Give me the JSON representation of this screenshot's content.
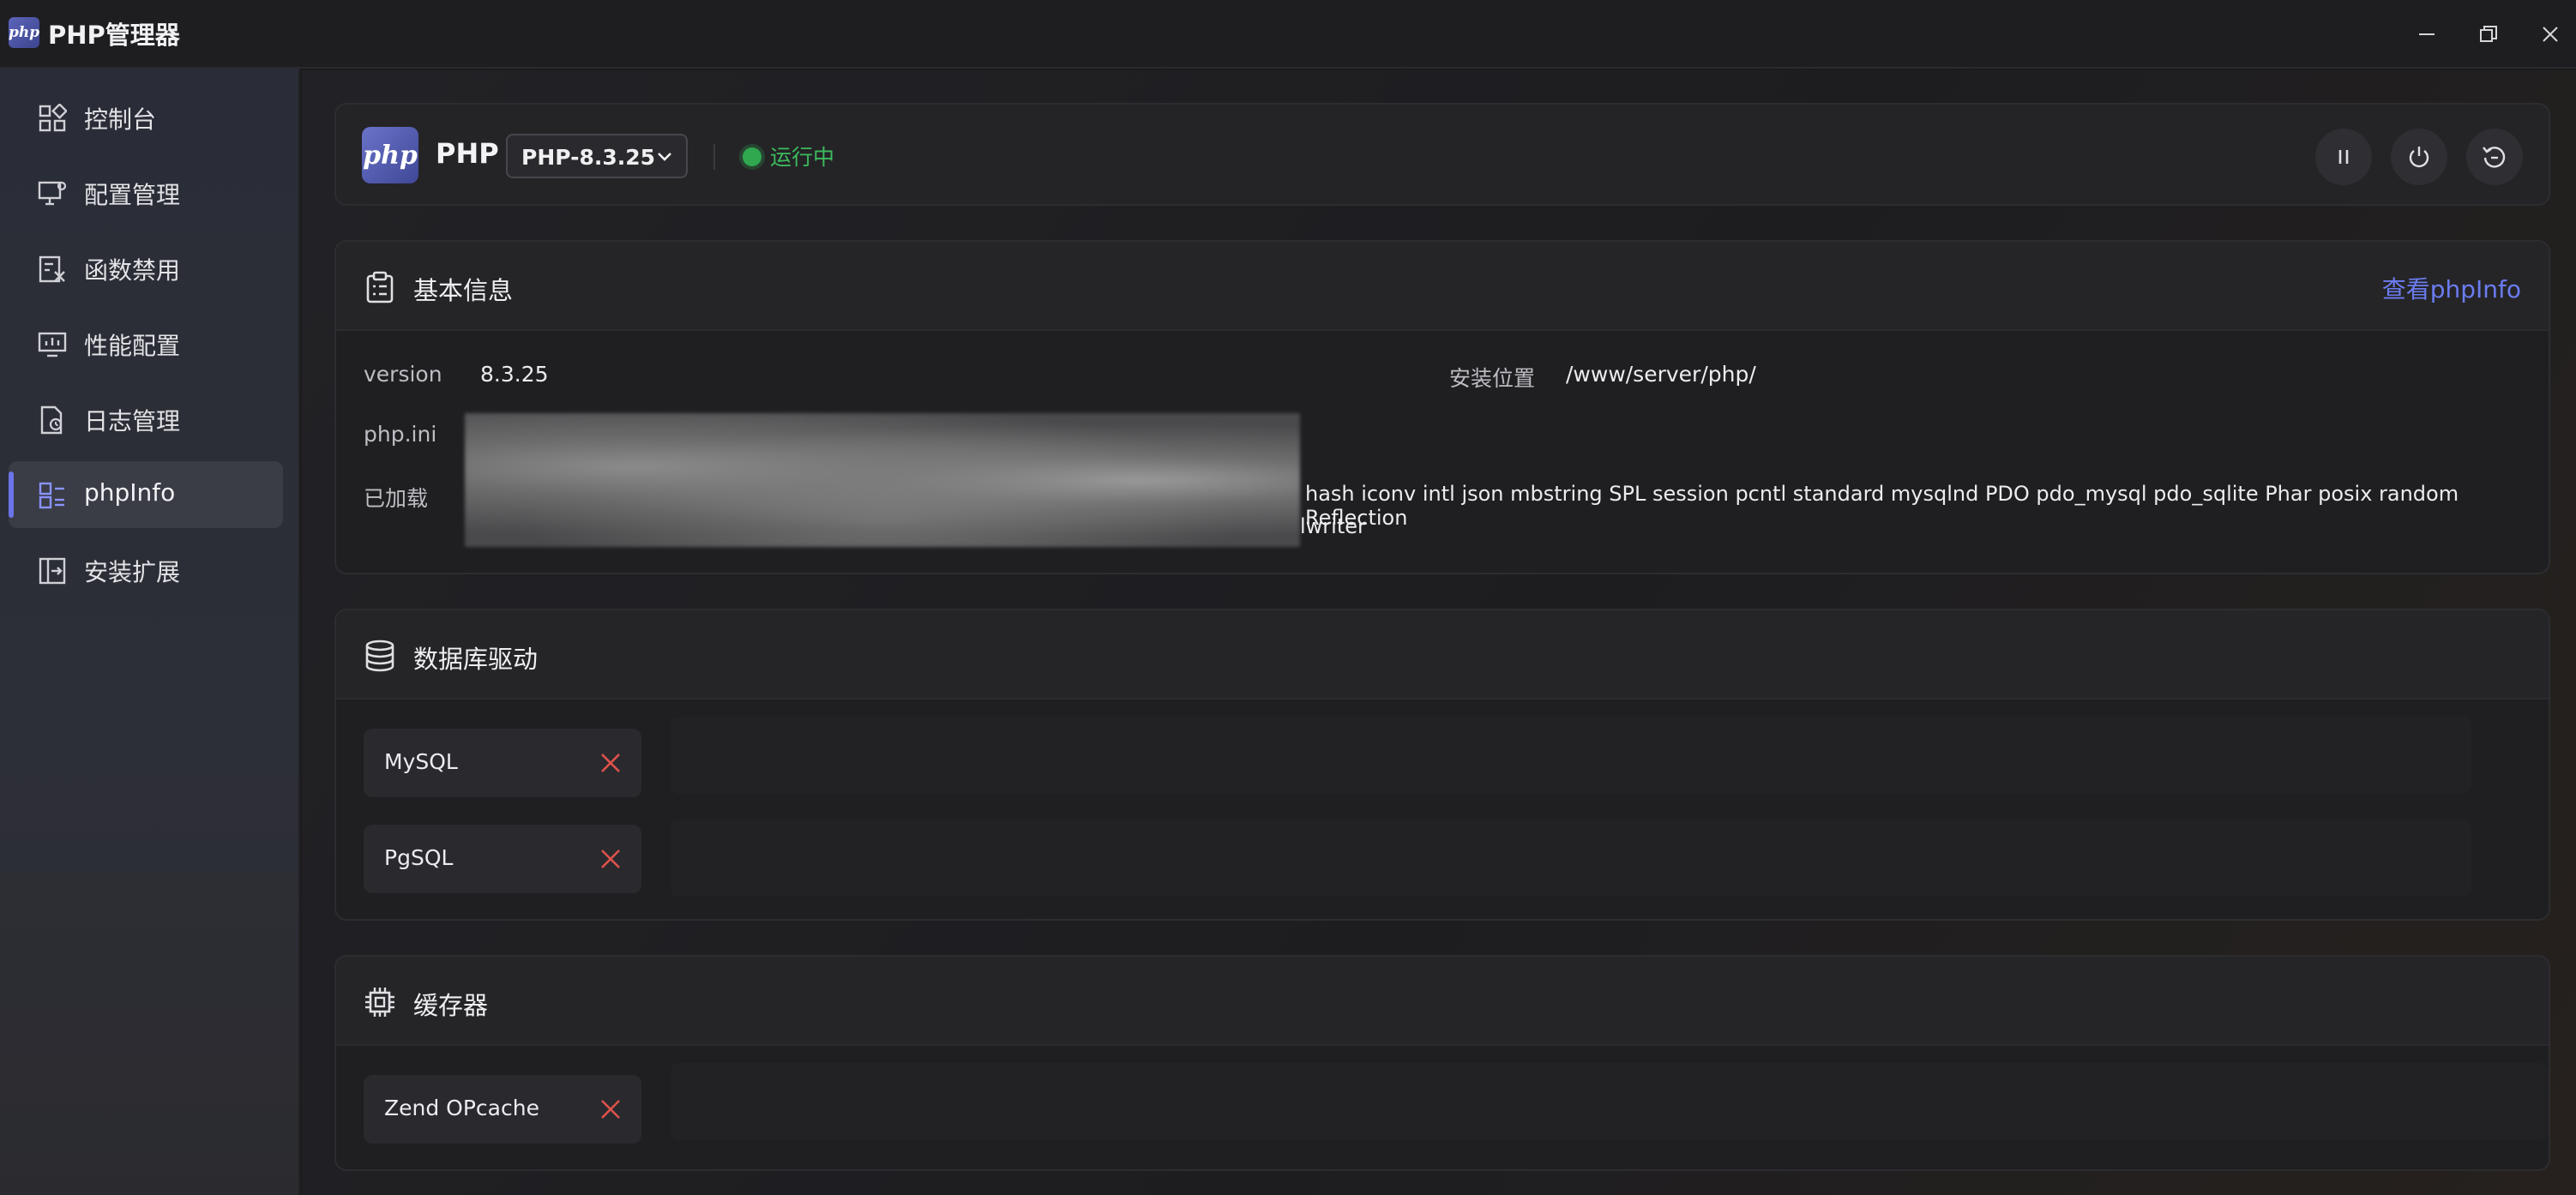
{
  "window": {
    "title": "PHP管理器",
    "logo_text": "php"
  },
  "sidebar": {
    "items": [
      {
        "label": "控制台",
        "icon": "dashboard-icon"
      },
      {
        "label": "配置管理",
        "icon": "config-monitor-icon"
      },
      {
        "label": "函数禁用",
        "icon": "function-disable-icon"
      },
      {
        "label": "性能配置",
        "icon": "performance-icon"
      },
      {
        "label": "日志管理",
        "icon": "log-icon"
      },
      {
        "label": "phpInfo",
        "icon": "phpinfo-icon",
        "active": true
      },
      {
        "label": "安装扩展",
        "icon": "install-extension-icon"
      }
    ]
  },
  "php_bar": {
    "logo_text": "php",
    "name": "PHP",
    "version_selected": "PHP-8.3.25",
    "status": "运行中",
    "status_color": "#3dbb5d"
  },
  "basic_info": {
    "title": "基本信息",
    "phpinfo_link": "查看phpInfo",
    "version_key": "version",
    "version_val": "8.3.25",
    "install_key": "安装位置",
    "install_val": "/www/server/php/",
    "ini_key": "php.ini",
    "loaded_key": "已加载",
    "loaded_line1": "hash iconv intl json mbstring SPL session pcntl standard mysqlnd PDO pdo_mysql pdo_sqlite Phar posix random Reflection",
    "loaded_line2": "lwriter"
  },
  "db_drivers": {
    "title": "数据库驱动",
    "items": [
      {
        "label": "MySQL"
      },
      {
        "label": "PgSQL"
      }
    ]
  },
  "cache": {
    "title": "缓存器",
    "items": [
      {
        "label": "Zend OPcache"
      }
    ]
  },
  "colors": {
    "accent": "#6b74e8",
    "link": "#6b7cf0",
    "disabled_x": "#e0524a"
  }
}
